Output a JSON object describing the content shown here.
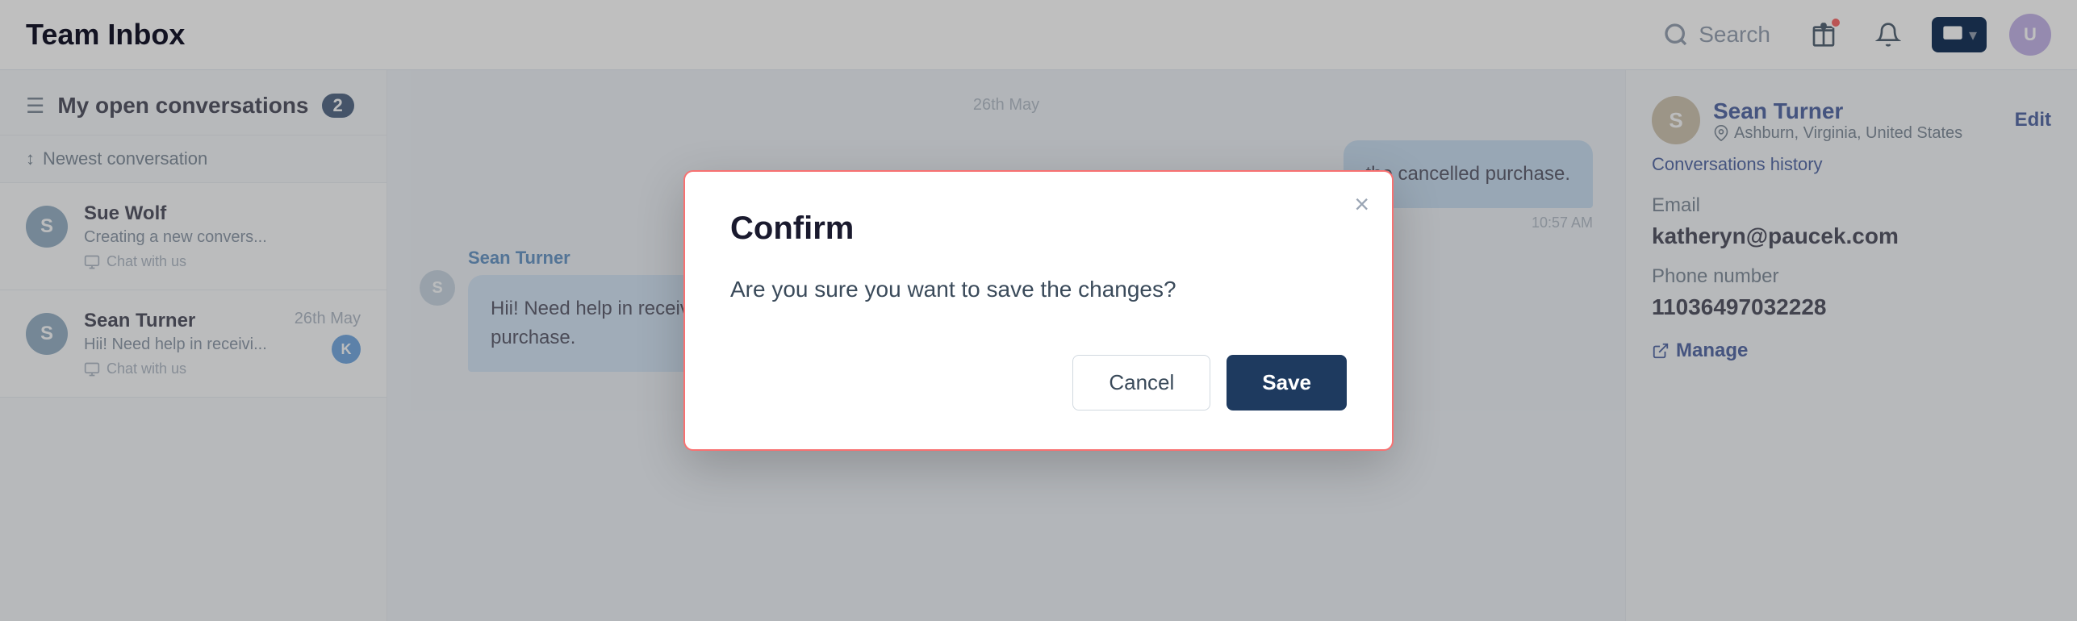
{
  "header": {
    "title": "Team Inbox",
    "search_placeholder": "Search"
  },
  "sidebar": {
    "title": "My open conversations",
    "count": "2",
    "sort_label": "Newest conversation",
    "conversations": [
      {
        "id": "sue-wolf",
        "name": "Sue Wolf",
        "preview": "Creating a new convers...",
        "channel": "Chat with us",
        "date": "",
        "avatar_letter": "S",
        "avatar_color": "#7a9bb5"
      },
      {
        "id": "sean-turner",
        "name": "Sean Turner",
        "preview": "Hii! Need help in receivi...",
        "channel": "Chat with us",
        "date": "26th May",
        "avatar_letter": "S",
        "avatar_color": "#7a9bb5",
        "agent_letter": "K"
      }
    ]
  },
  "chat": {
    "date_label": "26th May",
    "messages": [
      {
        "type": "right",
        "text": "the cancelled purchase.",
        "time": "10:57 AM"
      },
      {
        "type": "left",
        "sender": "Sean Turner",
        "text": "Hii! Need help in receiving the refund for the cancelled purchase.",
        "avatar_letter": "S"
      }
    ]
  },
  "right_panel": {
    "contact": {
      "name": "Sean Turner",
      "location": "Ashburn, Virginia, United States",
      "avatar_letter": "S",
      "avatar_color": "#c4b49a",
      "edit_label": "Edit",
      "conv_history_label": "Conversations history",
      "email_label": "Email",
      "email_value": "katheryn@paucek.com",
      "phone_label": "Phone number",
      "phone_value": "11036497032228",
      "manage_label": "Manage"
    }
  },
  "modal": {
    "title": "Confirm",
    "body": "Are you sure you want to save the changes?",
    "cancel_label": "Cancel",
    "save_label": "Save",
    "close_label": "×"
  }
}
